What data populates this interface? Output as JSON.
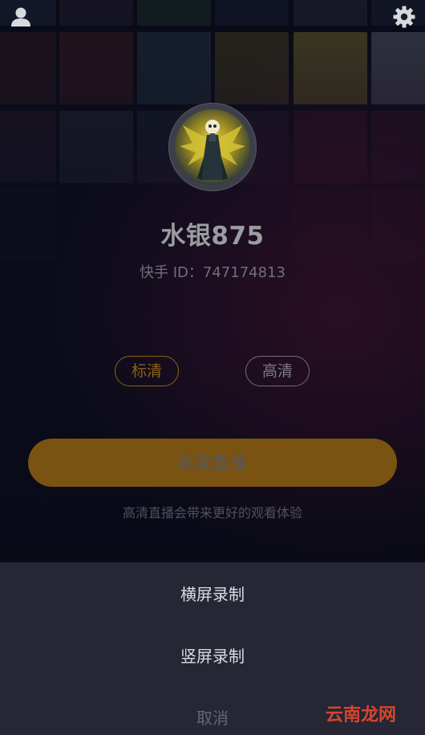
{
  "top_bar": {
    "left_icon": "user-profile-icon",
    "right_icon": "gear-icon"
  },
  "profile": {
    "avatar": "user-avatar",
    "name": "水银875",
    "id_text": "快手 ID：747174813"
  },
  "quality_options": [
    {
      "label": "标清",
      "selected": true
    },
    {
      "label": "高清",
      "selected": false
    }
  ],
  "go_live": {
    "label": "我要直播",
    "hint": "高清直播会带来更好的观看体验"
  },
  "action_sheet": {
    "items": [
      {
        "label": "横屏录制"
      },
      {
        "label": "竖屏录制"
      }
    ],
    "cancel_label": "取消"
  },
  "colors": {
    "accent": "#8c6212",
    "button_fill": "#7a5211",
    "sheet_bg": "#262634",
    "watermark": "#d6462c"
  },
  "watermark": {
    "text": "云南龙网"
  }
}
